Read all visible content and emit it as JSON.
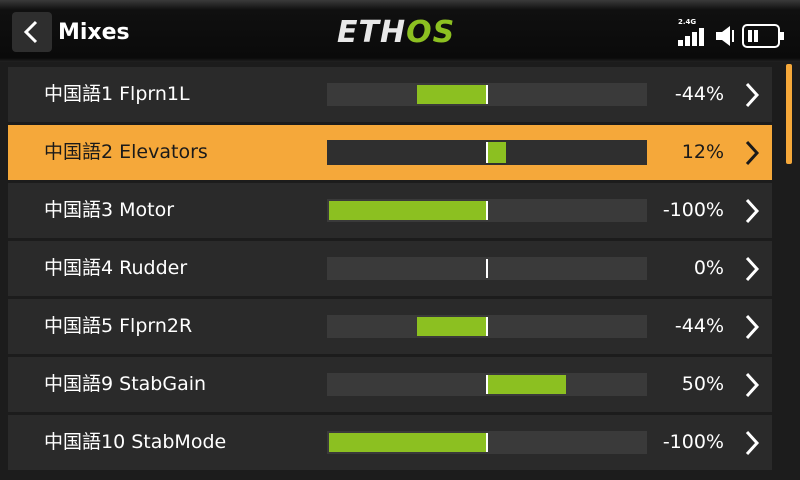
{
  "header": {
    "title": "Mixes",
    "logo_part1": "ETH",
    "logo_part2": "OS",
    "signal_label": "2.4G",
    "back_icon": "chevron-left-icon",
    "signal_icon": "signal-bars-icon",
    "volume_icon": "speaker-icon",
    "battery_icon": "battery-icon"
  },
  "colors": {
    "accent": "#f5a83a",
    "bar_fill": "#8cc021",
    "row_bg": "#2a2a2a",
    "background": "#1c1c1c"
  },
  "mixes": [
    {
      "label": "中国語1 Flprn1L",
      "value_text": "-44%",
      "value": -44,
      "selected": false
    },
    {
      "label": "中国語2 Elevators",
      "value_text": "12%",
      "value": 12,
      "selected": true
    },
    {
      "label": "中国語3 Motor",
      "value_text": "-100%",
      "value": -100,
      "selected": false
    },
    {
      "label": "中国語4 Rudder",
      "value_text": "0%",
      "value": 0,
      "selected": false
    },
    {
      "label": "中国語5 Flprn2R",
      "value_text": "-44%",
      "value": -44,
      "selected": false
    },
    {
      "label": "中国語9 StabGain",
      "value_text": "50%",
      "value": 50,
      "selected": false
    },
    {
      "label": "中国語10 StabMode",
      "value_text": "-100%",
      "value": -100,
      "selected": false
    }
  ]
}
